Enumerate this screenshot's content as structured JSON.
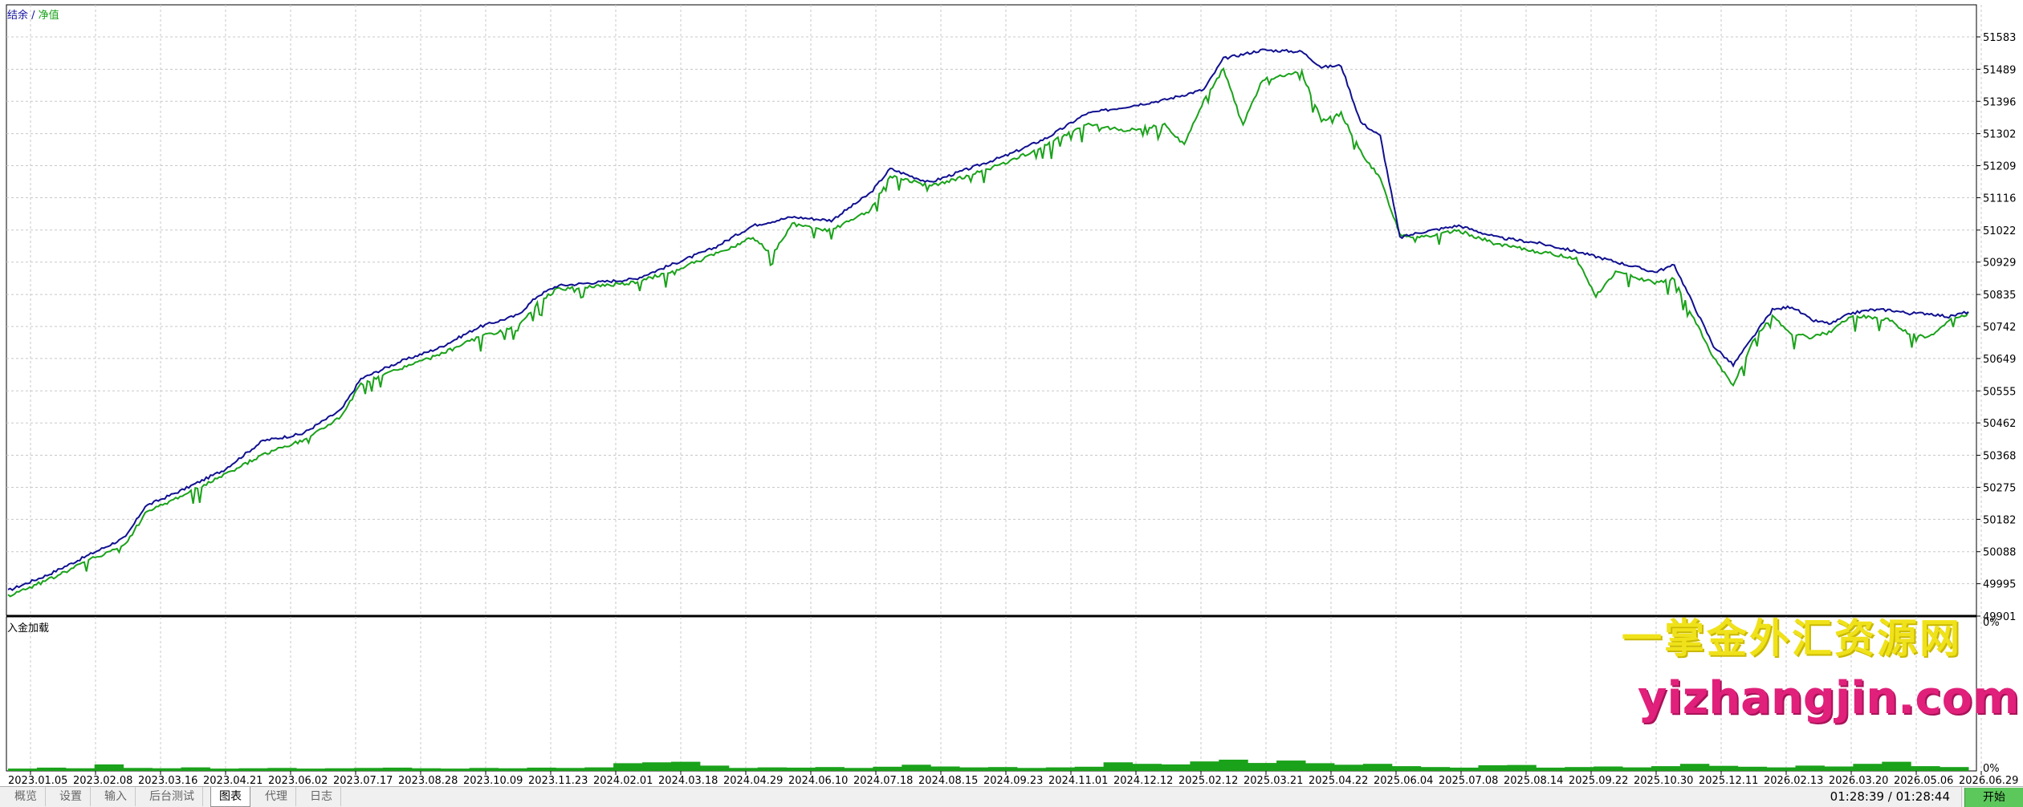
{
  "chart_data": [
    {
      "type": "line",
      "legend": {
        "balance_label": "结余",
        "separator": " / ",
        "equity_label": "净值"
      },
      "y_ticks": [
        "51583",
        "51489",
        "51396",
        "51302",
        "51209",
        "51116",
        "51022",
        "50929",
        "50835",
        "50742",
        "50649",
        "50555",
        "50462",
        "50368",
        "50275",
        "50182",
        "50088",
        "49995",
        "49901"
      ],
      "ylim": [
        49901,
        51676
      ],
      "x_ticks": [
        "2023.01.05",
        "2023.02.08",
        "2023.03.16",
        "2023.04.21",
        "2023.06.02",
        "2023.07.17",
        "2023.08.28",
        "2023.10.09",
        "2023.11.23",
        "2024.02.01",
        "2024.03.18",
        "2024.04.29",
        "2024.06.10",
        "2024.07.18",
        "2024.08.15",
        "2024.09.23",
        "2024.11.01",
        "2024.12.12",
        "2025.02.12",
        "2025.03.21",
        "2025.04.22",
        "2025.06.04",
        "2025.07.08",
        "2025.08.14",
        "2025.09.22",
        "2025.10.30",
        "2025.12.11",
        "2026.02.13",
        "2026.03.20",
        "2026.05.06",
        "2026.06.29"
      ],
      "series": [
        {
          "name": "结余",
          "color": "#101090",
          "points": [
            [
              0,
              49975
            ],
            [
              0.02,
              50020
            ],
            [
              0.04,
              50075
            ],
            [
              0.06,
              50130
            ],
            [
              0.07,
              50220
            ],
            [
              0.09,
              50270
            ],
            [
              0.11,
              50325
            ],
            [
              0.13,
              50410
            ],
            [
              0.15,
              50430
            ],
            [
              0.17,
              50500
            ],
            [
              0.18,
              50590
            ],
            [
              0.2,
              50640
            ],
            [
              0.22,
              50680
            ],
            [
              0.24,
              50740
            ],
            [
              0.26,
              50775
            ],
            [
              0.27,
              50830
            ],
            [
              0.28,
              50860
            ],
            [
              0.3,
              50870
            ],
            [
              0.32,
              50880
            ],
            [
              0.34,
              50925
            ],
            [
              0.36,
              50970
            ],
            [
              0.38,
              51035
            ],
            [
              0.4,
              51060
            ],
            [
              0.42,
              51050
            ],
            [
              0.44,
              51130
            ],
            [
              0.45,
              51200
            ],
            [
              0.47,
              51160
            ],
            [
              0.49,
              51200
            ],
            [
              0.51,
              51240
            ],
            [
              0.53,
              51290
            ],
            [
              0.55,
              51360
            ],
            [
              0.57,
              51380
            ],
            [
              0.59,
              51400
            ],
            [
              0.61,
              51430
            ],
            [
              0.62,
              51520
            ],
            [
              0.64,
              51545
            ],
            [
              0.66,
              51540
            ],
            [
              0.67,
              51495
            ],
            [
              0.68,
              51500
            ],
            [
              0.69,
              51335
            ],
            [
              0.7,
              51295
            ],
            [
              0.71,
              51000
            ],
            [
              0.72,
              51015
            ],
            [
              0.74,
              51035
            ],
            [
              0.76,
              51000
            ],
            [
              0.78,
              50985
            ],
            [
              0.8,
              50960
            ],
            [
              0.82,
              50930
            ],
            [
              0.84,
              50900
            ],
            [
              0.85,
              50920
            ],
            [
              0.87,
              50685
            ],
            [
              0.88,
              50630
            ],
            [
              0.89,
              50710
            ],
            [
              0.9,
              50790
            ],
            [
              0.91,
              50800
            ],
            [
              0.92,
              50760
            ],
            [
              0.93,
              50750
            ],
            [
              0.94,
              50780
            ],
            [
              0.95,
              50790
            ],
            [
              0.96,
              50790
            ],
            [
              0.97,
              50780
            ],
            [
              0.98,
              50780
            ],
            [
              0.99,
              50770
            ],
            [
              1.0,
              50785
            ]
          ]
        },
        {
          "name": "净值",
          "color": "#1aa21a",
          "points": [
            [
              0,
              49960
            ],
            [
              0.02,
              50005
            ],
            [
              0.04,
              50060
            ],
            [
              0.06,
              50110
            ],
            [
              0.07,
              50200
            ],
            [
              0.09,
              50255
            ],
            [
              0.11,
              50310
            ],
            [
              0.13,
              50370
            ],
            [
              0.15,
              50410
            ],
            [
              0.17,
              50480
            ],
            [
              0.18,
              50575
            ],
            [
              0.2,
              50620
            ],
            [
              0.22,
              50660
            ],
            [
              0.24,
              50710
            ],
            [
              0.26,
              50740
            ],
            [
              0.27,
              50810
            ],
            [
              0.28,
              50850
            ],
            [
              0.3,
              50860
            ],
            [
              0.32,
              50870
            ],
            [
              0.34,
              50905
            ],
            [
              0.36,
              50950
            ],
            [
              0.38,
              51000
            ],
            [
              0.39,
              50950
            ],
            [
              0.4,
              51040
            ],
            [
              0.42,
              51020
            ],
            [
              0.44,
              51080
            ],
            [
              0.45,
              51180
            ],
            [
              0.47,
              51150
            ],
            [
              0.49,
              51180
            ],
            [
              0.51,
              51220
            ],
            [
              0.53,
              51270
            ],
            [
              0.55,
              51330
            ],
            [
              0.57,
              51310
            ],
            [
              0.59,
              51330
            ],
            [
              0.6,
              51270
            ],
            [
              0.61,
              51400
            ],
            [
              0.62,
              51490
            ],
            [
              0.63,
              51330
            ],
            [
              0.64,
              51460
            ],
            [
              0.66,
              51480
            ],
            [
              0.67,
              51340
            ],
            [
              0.68,
              51360
            ],
            [
              0.69,
              51250
            ],
            [
              0.7,
              51170
            ],
            [
              0.71,
              51010
            ],
            [
              0.72,
              51000
            ],
            [
              0.74,
              51020
            ],
            [
              0.76,
              50980
            ],
            [
              0.78,
              50960
            ],
            [
              0.8,
              50940
            ],
            [
              0.81,
              50830
            ],
            [
              0.82,
              50900
            ],
            [
              0.84,
              50870
            ],
            [
              0.85,
              50880
            ],
            [
              0.87,
              50650
            ],
            [
              0.88,
              50570
            ],
            [
              0.89,
              50700
            ],
            [
              0.9,
              50770
            ],
            [
              0.91,
              50720
            ],
            [
              0.92,
              50710
            ],
            [
              0.93,
              50730
            ],
            [
              0.94,
              50770
            ],
            [
              0.95,
              50770
            ],
            [
              0.96,
              50760
            ],
            [
              0.97,
              50720
            ],
            [
              0.98,
              50710
            ],
            [
              0.99,
              50760
            ],
            [
              1.0,
              50780
            ]
          ]
        }
      ]
    },
    {
      "type": "area",
      "title": "入金加载",
      "y_ticks": [
        "0%",
        "0%"
      ],
      "series": [
        {
          "name": "入金加载",
          "color": "#1aa21a",
          "values": [
            0.8,
            1.1,
            0.9,
            2.2,
            1.0,
            0.9,
            1.2,
            0.8,
            0.9,
            1.0,
            0.8,
            0.9,
            1.0,
            1.1,
            0.9,
            0.8,
            1.0,
            0.9,
            1.1,
            1.0,
            1.2,
            2.6,
            2.9,
            3.1,
            1.8,
            1.0,
            1.2,
            1.1,
            1.3,
            1.0,
            1.4,
            2.1,
            1.5,
            1.2,
            1.3,
            1.0,
            1.2,
            1.4,
            2.9,
            2.4,
            2.2,
            3.2,
            3.8,
            2.7,
            3.5,
            2.6,
            2.1,
            2.4,
            1.6,
            1.3,
            1.1,
            1.9,
            2.0,
            1.1,
            1.3,
            1.5,
            1.2,
            1.6,
            2.4,
            1.7,
            1.4,
            1.2,
            1.8,
            1.5,
            2.4,
            3.1,
            1.6,
            1.3
          ]
        }
      ]
    }
  ],
  "watermark": {
    "line1": "一掌金外汇资源网",
    "line2": "yizhangjin.com"
  },
  "tabs": [
    {
      "label": "概览"
    },
    {
      "label": "设置"
    },
    {
      "label": "输入"
    },
    {
      "label": "后台测试"
    },
    {
      "label": "图表"
    },
    {
      "label": "代理"
    },
    {
      "label": "日志"
    }
  ],
  "status": {
    "clock": "01:28:39 / 01:28:44",
    "start_label": "开始"
  },
  "colors": {
    "balance": "#101090",
    "equity": "#1aa21a",
    "grid": "#c8c8c8",
    "start_button": "#5cc85c"
  }
}
